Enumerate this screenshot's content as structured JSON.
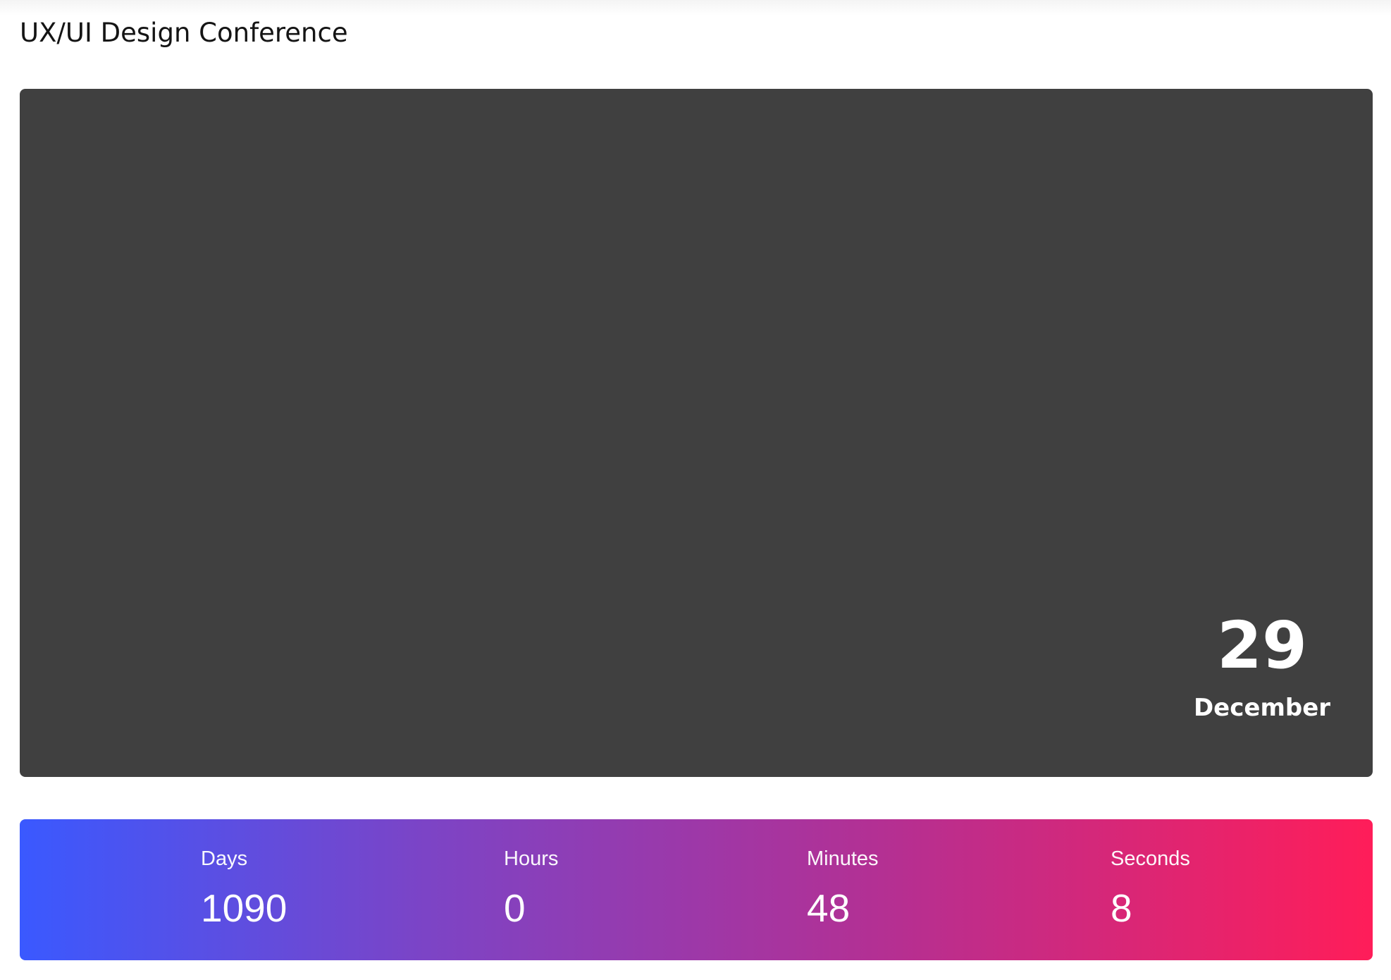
{
  "page": {
    "title": "UX/UI Design Conference"
  },
  "event_date": {
    "day": "29",
    "month": "December"
  },
  "countdown": {
    "units": [
      {
        "label": "Days",
        "value": "1090"
      },
      {
        "label": "Hours",
        "value": "0"
      },
      {
        "label": "Minutes",
        "value": "48"
      },
      {
        "label": "Seconds",
        "value": "8"
      }
    ]
  },
  "colors": {
    "hero_background": "#404040",
    "gradient_start": "#3a59ff",
    "gradient_end": "#ff1d59",
    "text_on_dark": "#ffffff",
    "title_text": "#141414"
  }
}
